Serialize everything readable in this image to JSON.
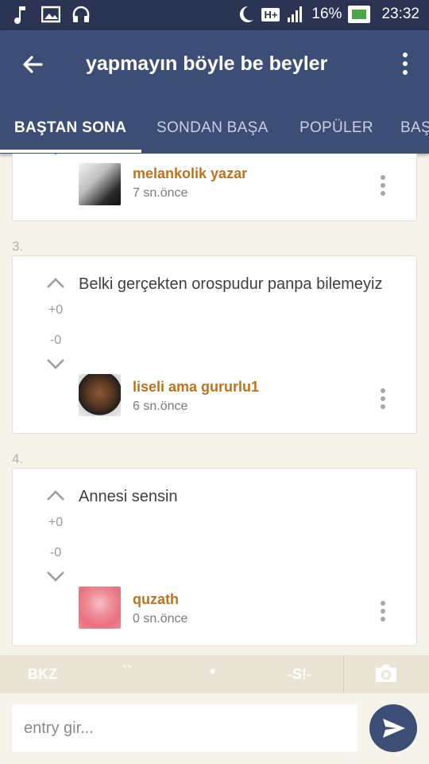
{
  "status_bar": {
    "battery": "16%",
    "time": "23:32",
    "network": "H+"
  },
  "app_bar": {
    "title": "yapmayın böyle be beyler"
  },
  "tabs": [
    {
      "label": "BAŞTAN SONA",
      "active": true
    },
    {
      "label": "SONDAN BAŞA",
      "active": false
    },
    {
      "label": "POPÜLER",
      "active": false
    },
    {
      "label": "BAŞ",
      "active": false
    }
  ],
  "entries": [
    {
      "number": "",
      "text": "",
      "author": "melankolik yazar",
      "time": "7 sn.önce",
      "up": "",
      "down": ""
    },
    {
      "number": "3.",
      "text": "Belki gerçekten orospudur panpa bilemeyiz",
      "author": "liseli ama gururlu1",
      "time": "6 sn.önce",
      "up": "+0",
      "down": "-0"
    },
    {
      "number": "4.",
      "text": "Annesi sensin",
      "author": "quzath",
      "time": "0 sn.önce",
      "up": "+0",
      "down": "-0"
    }
  ],
  "shortcuts": {
    "bkz": "BKZ",
    "backticks": "``",
    "star": "*",
    "spoiler": "-S!-"
  },
  "input": {
    "placeholder": "entry gir..."
  },
  "colors": {
    "status_bar": "#2b3553",
    "app_bar": "#3c4e75",
    "author": "#c07218",
    "background": "#f5f3ea"
  }
}
